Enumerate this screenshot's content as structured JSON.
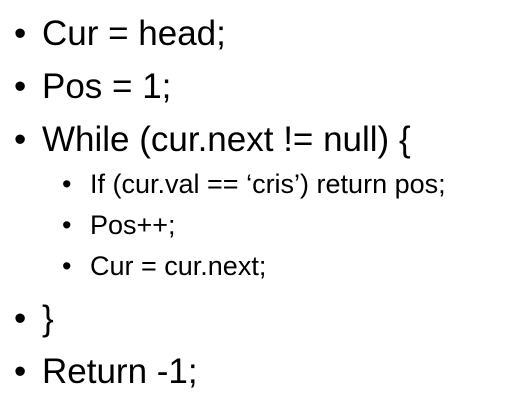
{
  "bullet_char": "•",
  "items": [
    {
      "text": "Cur = head;"
    },
    {
      "text": "Pos = 1;"
    },
    {
      "text": "While (cur.next != null) {"
    },
    {
      "text": "If (cur.val == ‘cris’) return pos;"
    },
    {
      "text": "Pos++;"
    },
    {
      "text": "Cur = cur.next;"
    },
    {
      "text": "}"
    },
    {
      "text": "Return -1;"
    }
  ]
}
